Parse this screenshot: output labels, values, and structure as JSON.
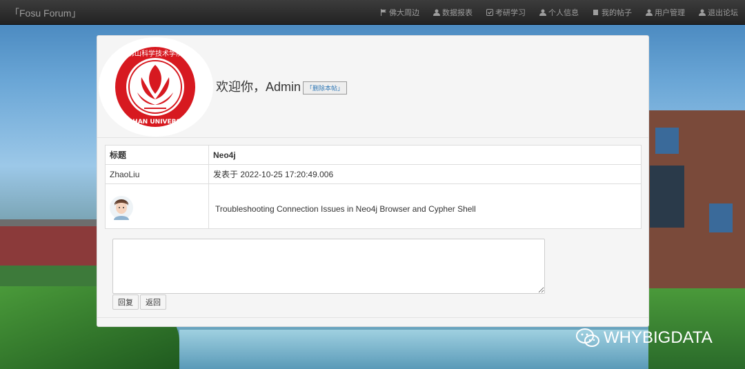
{
  "navbar": {
    "brand": "「Fosu Forum」",
    "items": [
      {
        "label": "佛大周边",
        "icon": "flag-icon"
      },
      {
        "label": "数据报表",
        "icon": "user-icon"
      },
      {
        "label": "考研学习",
        "icon": "check-square-icon"
      },
      {
        "label": "个人信息",
        "icon": "user-icon"
      },
      {
        "label": "我的帖子",
        "icon": "book-icon"
      },
      {
        "label": "用户管理",
        "icon": "user-icon"
      },
      {
        "label": "退出论坛",
        "icon": "user-icon"
      }
    ]
  },
  "header": {
    "logo_text": "佛山科学技术学院 FOSHAN UNIVERSITY",
    "welcome": "欢迎你，Admin",
    "delete_button": "「删除本帖」"
  },
  "post": {
    "title_label": "标题",
    "title": "Neo4j",
    "author": "ZhaoLiu",
    "posted_at": "发表于  2022-10-25 17:20:49.006",
    "content": "Troubleshooting Connection Issues in Neo4j Browser and Cypher Shell"
  },
  "reply": {
    "textarea_value": "",
    "reply_button": "回复",
    "back_button": "返回"
  },
  "watermark": "WHYBIGDATA",
  "colors": {
    "navbar": "#222222",
    "link": "#337ab7",
    "logo_red": "#d71920"
  }
}
